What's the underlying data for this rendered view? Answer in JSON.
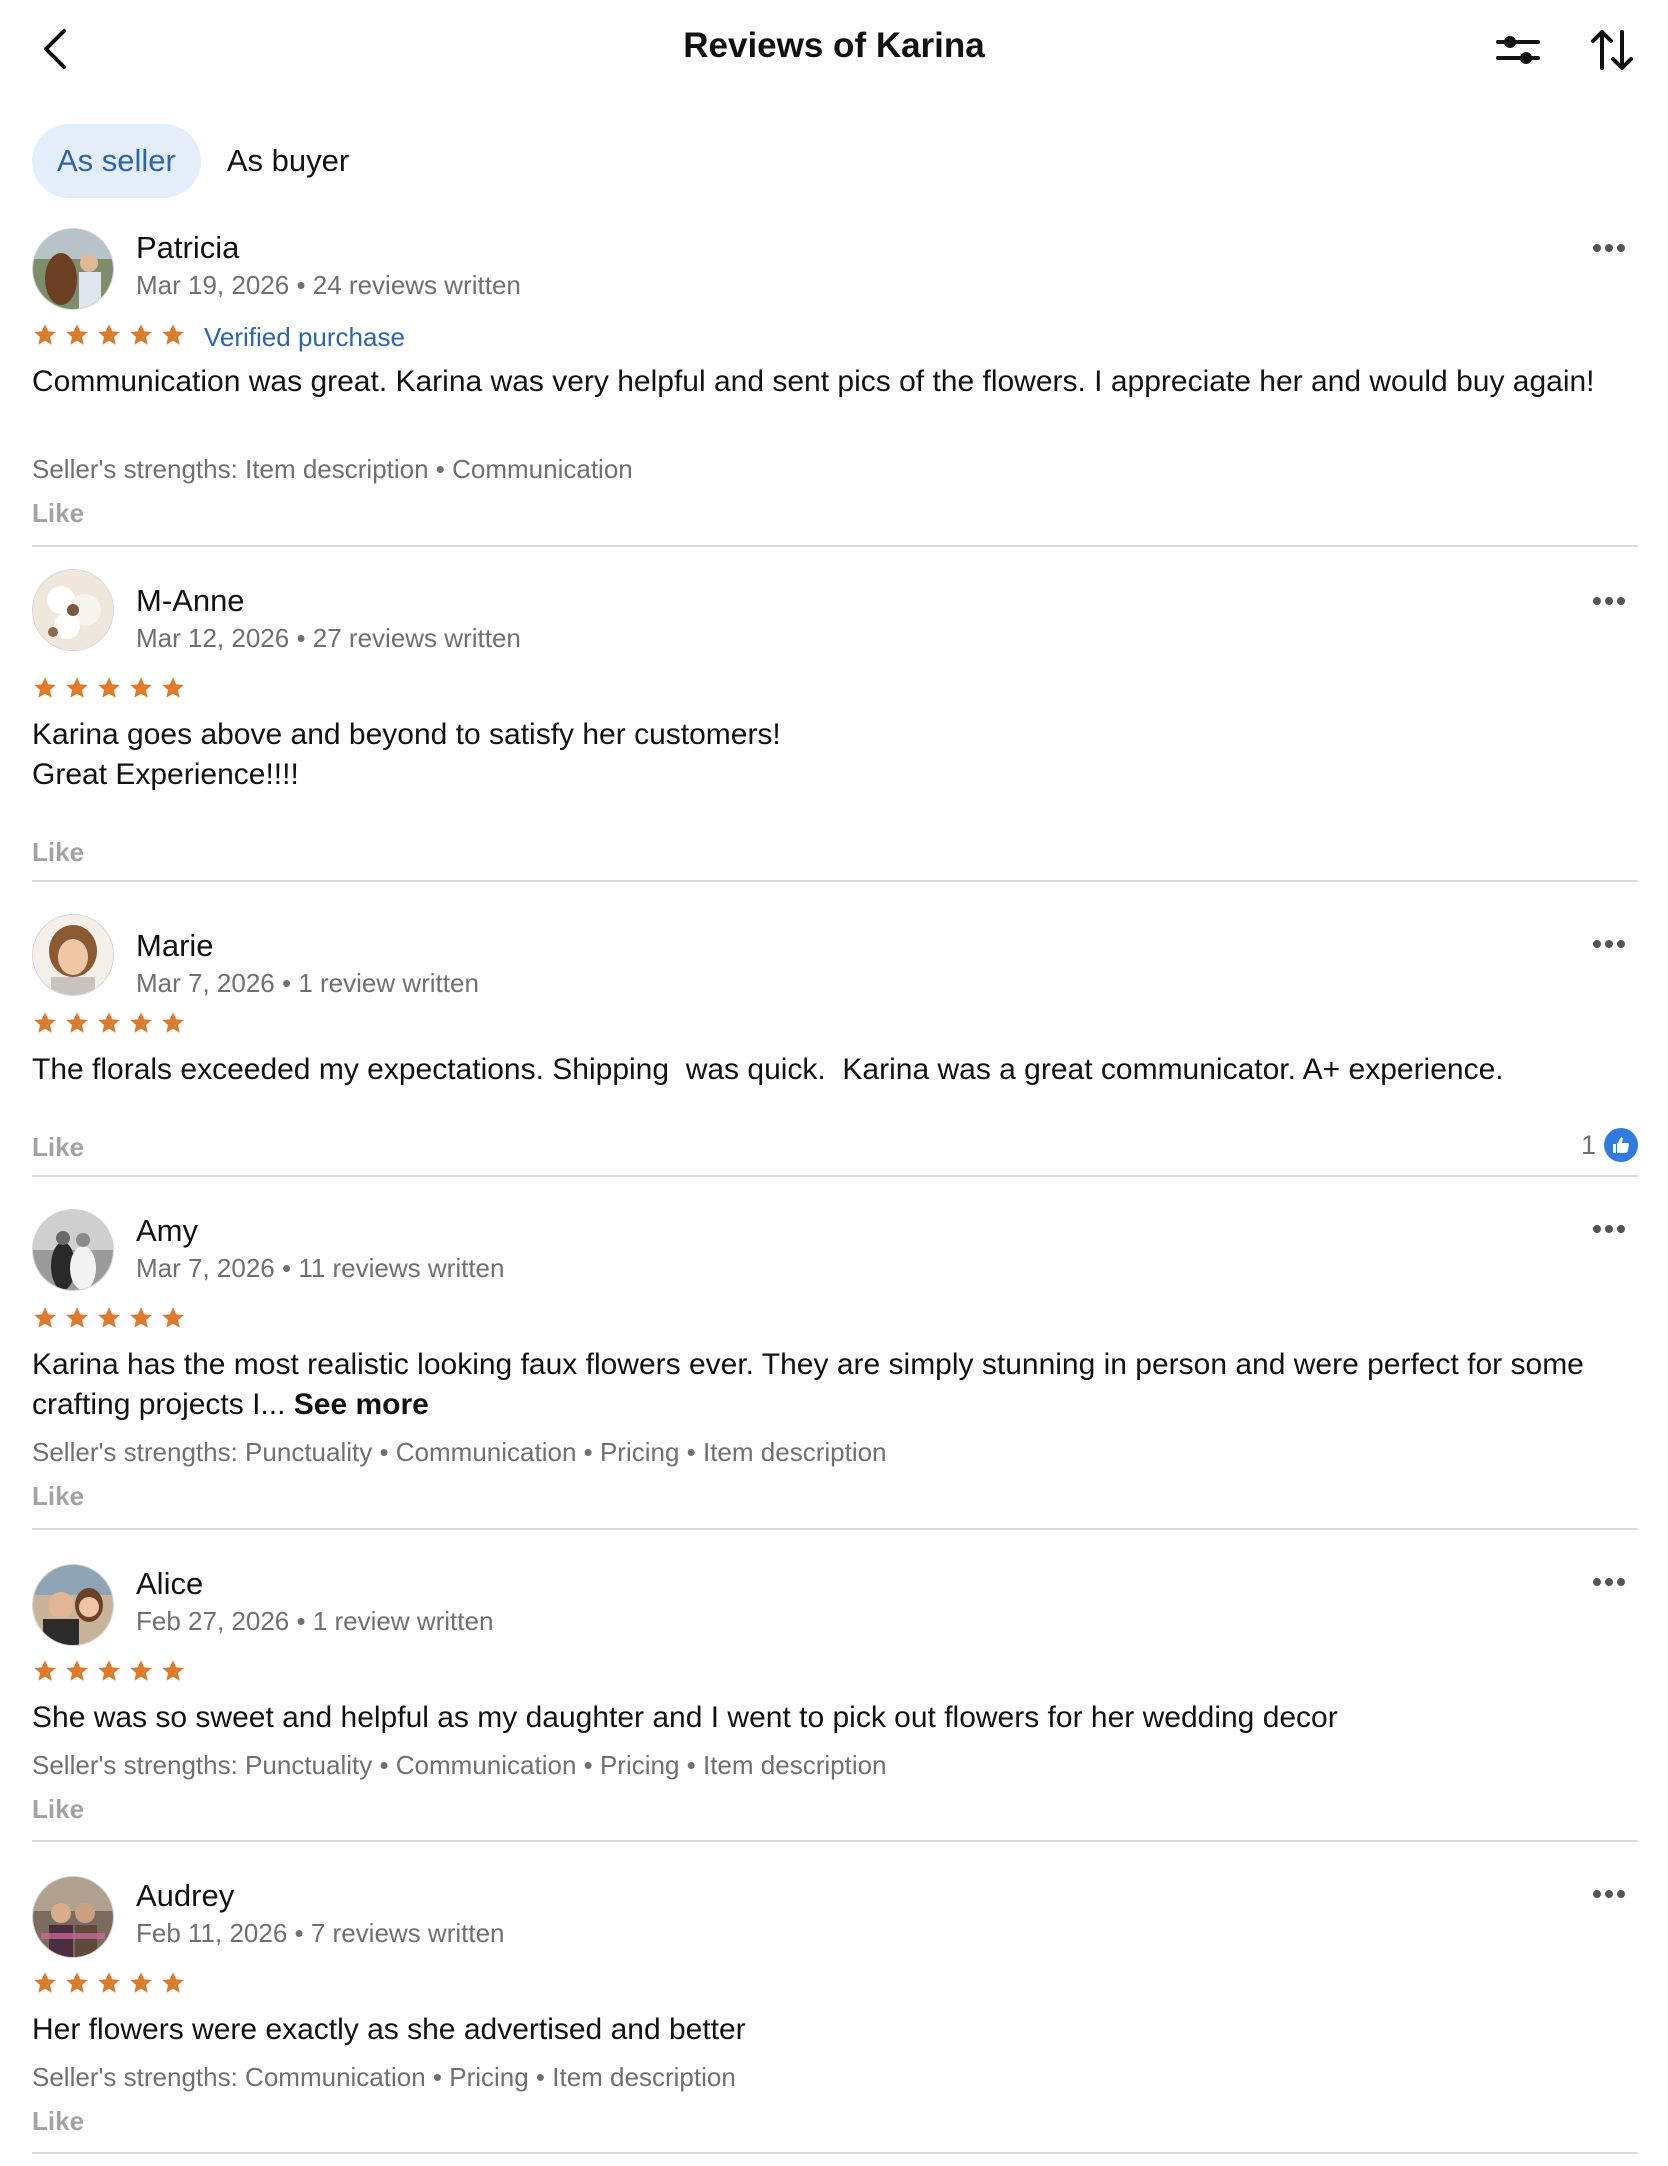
{
  "header": {
    "title": "Reviews of Karina"
  },
  "tabs": [
    {
      "label": "As seller",
      "active": true
    },
    {
      "label": "As buyer",
      "active": false
    }
  ],
  "colors": {
    "accent": "#2f63ad",
    "tab_active_bg": "#e4eefb",
    "star": "#e07a2e",
    "like_badge": "#2f7be0"
  },
  "reviews": [
    {
      "name": "Patricia",
      "date": "Mar 19, 2026",
      "reviews_written": "24 reviews written",
      "rating": 5,
      "verified": "Verified purchase",
      "text": "Communication was great. Karina was very helpful and sent pics of the flowers. I appreciate her and would buy again!",
      "strengths": "Seller's strengths: Item description • Communication",
      "like_label": "Like"
    },
    {
      "name": "M-Anne",
      "date": "Mar 12, 2026",
      "reviews_written": "27 reviews written",
      "rating": 5,
      "text_line1": "Karina goes above and beyond to satisfy her customers!",
      "text_line2": "Great Experience!!!!",
      "like_label": "Like"
    },
    {
      "name": "Marie",
      "date": "Mar 7, 2026",
      "reviews_written": "1 review written",
      "rating": 5,
      "text": "The florals exceeded my expectations. Shipping  was quick.  Karina was a great communicator. A+ experience.",
      "like_label": "Like",
      "like_count": "1"
    },
    {
      "name": "Amy",
      "date": "Mar 7, 2026",
      "reviews_written": "11 reviews written",
      "rating": 5,
      "text": "Karina has the most realistic looking faux flowers ever. They are simply stunning in person and were perfect for some crafting projects I...",
      "see_more": "See more",
      "strengths": "Seller's strengths: Punctuality • Communication • Pricing • Item description",
      "like_label": "Like"
    },
    {
      "name": "Alice",
      "date": "Feb 27, 2026",
      "reviews_written": "1 review written",
      "rating": 5,
      "text": "She was so sweet and helpful as my daughter and I went to pick out flowers for her wedding decor",
      "strengths": "Seller's strengths: Punctuality • Communication • Pricing • Item description",
      "like_label": "Like"
    },
    {
      "name": "Audrey",
      "date": "Feb 11, 2026",
      "reviews_written": "7 reviews written",
      "rating": 5,
      "text": "Her flowers were exactly as she advertised and better",
      "strengths": "Seller's strengths: Communication • Pricing • Item description",
      "like_label": "Like"
    }
  ]
}
